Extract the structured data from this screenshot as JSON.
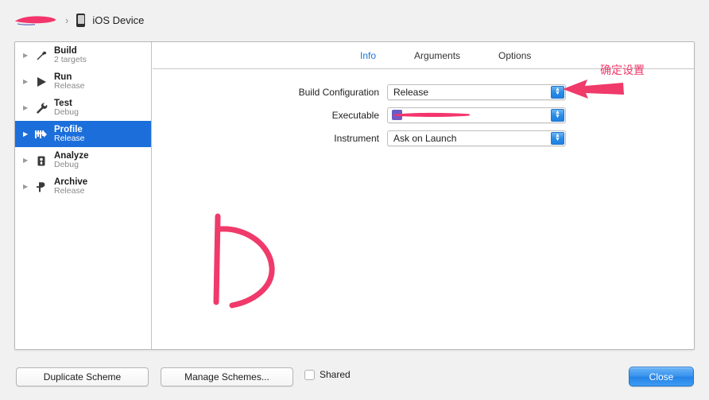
{
  "topbar": {
    "scheme_name_redacted": "",
    "separator": "›",
    "device_icon": "iphone-icon",
    "device_label": "iOS Device"
  },
  "sidebar": {
    "items": [
      {
        "title": "Build",
        "subtitle": "2 targets",
        "icon": "hammer-icon",
        "selected": false,
        "disclosure": "▶"
      },
      {
        "title": "Run",
        "subtitle": "Release",
        "icon": "play-icon",
        "selected": false,
        "disclosure": "▶"
      },
      {
        "title": "Test",
        "subtitle": "Debug",
        "icon": "wrench-icon",
        "selected": false,
        "disclosure": "▶"
      },
      {
        "title": "Profile",
        "subtitle": "Release",
        "icon": "speedometer-icon",
        "selected": true,
        "disclosure": "▶"
      },
      {
        "title": "Analyze",
        "subtitle": "Debug",
        "icon": "microscope-icon",
        "selected": false,
        "disclosure": "▶"
      },
      {
        "title": "Archive",
        "subtitle": "Release",
        "icon": "archive-pin-icon",
        "selected": false,
        "disclosure": "▶"
      }
    ]
  },
  "tabs": [
    {
      "label": "Info",
      "active": true
    },
    {
      "label": "Arguments",
      "active": false
    },
    {
      "label": "Options",
      "active": false
    }
  ],
  "form": {
    "rows": [
      {
        "label": "Build Configuration",
        "value": "Release",
        "redacted": false
      },
      {
        "label": "Executable",
        "value": "",
        "redacted": true
      },
      {
        "label": "Instrument",
        "value": "Ask on Launch",
        "redacted": false
      }
    ],
    "stepper_glyph_up": "▲",
    "stepper_glyph_down": "▼"
  },
  "bottom": {
    "duplicate_scheme": "Duplicate Scheme",
    "manage_schemes": "Manage Schemes...",
    "shared_label": "Shared",
    "shared_checked": false,
    "close": "Close"
  },
  "annotations": {
    "text": "确定设置",
    "arrow": "left-arrow-annotation",
    "letter_mark": "handdrawn-letter-d",
    "color": "#ef3a6a"
  }
}
